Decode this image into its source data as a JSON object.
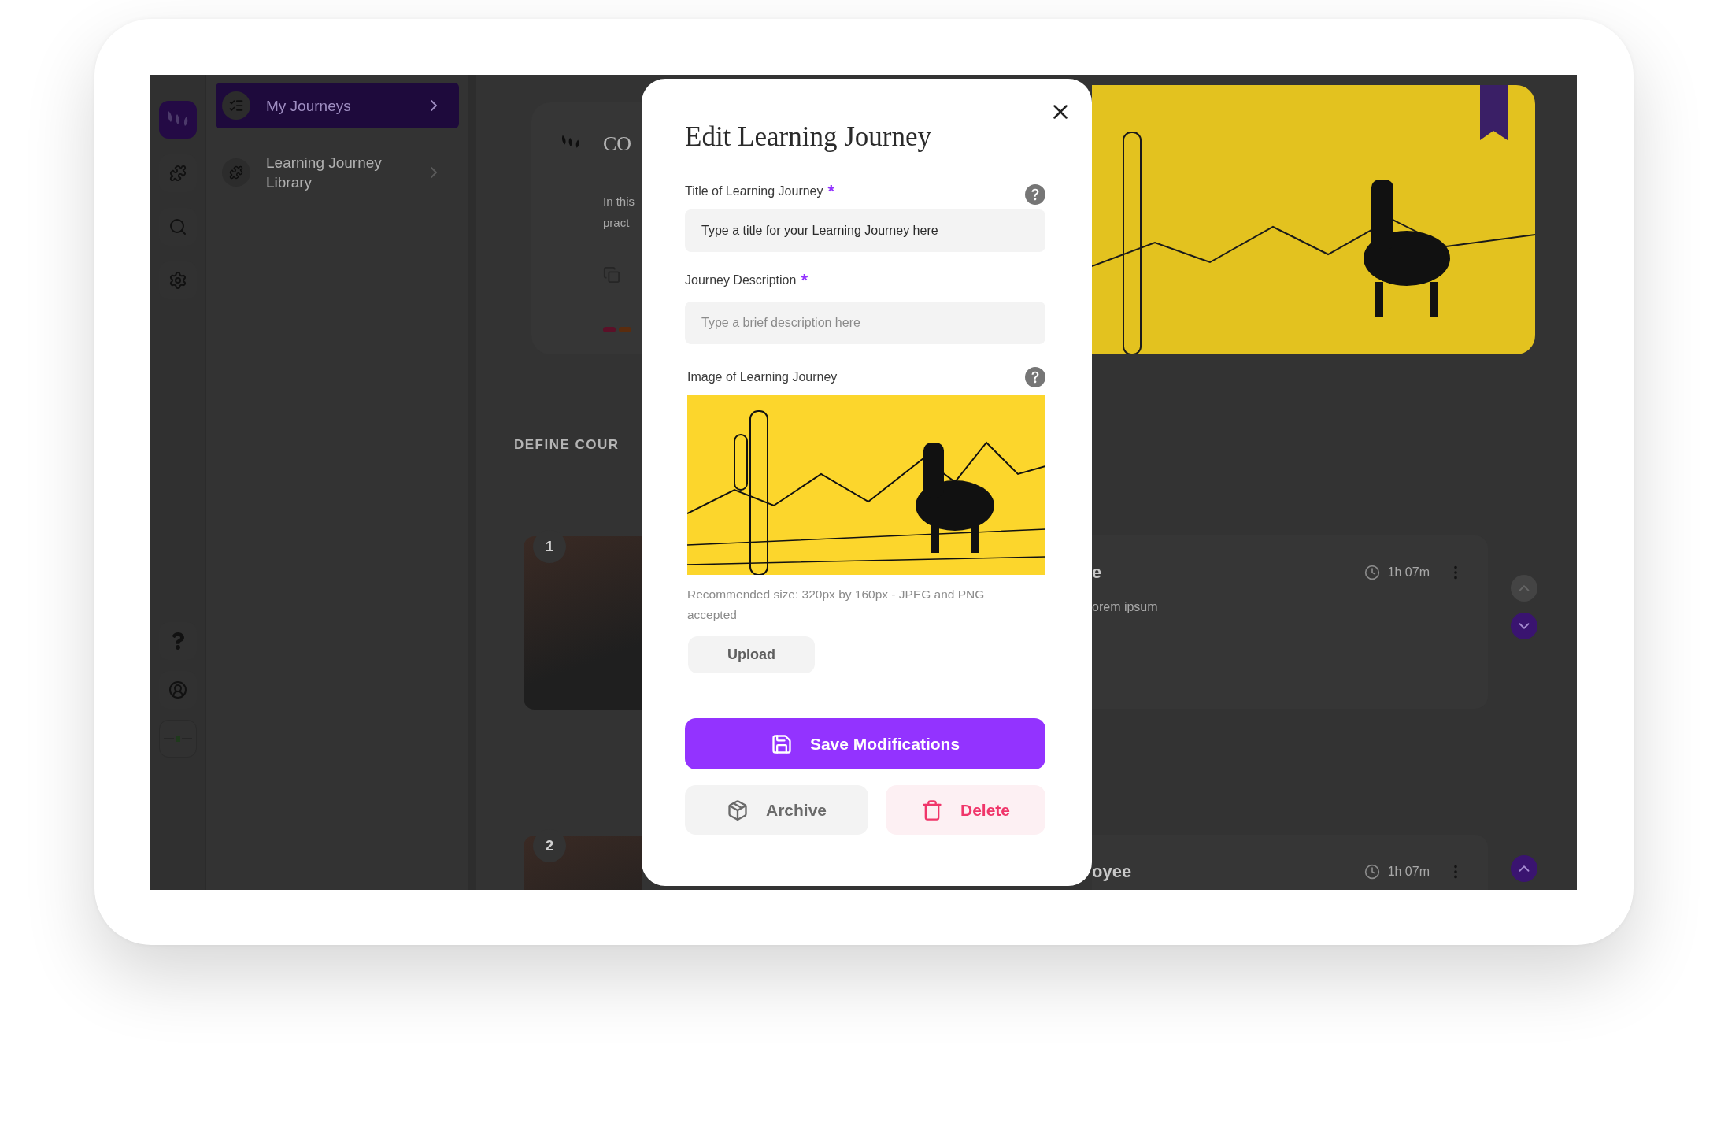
{
  "rail": [
    {
      "kind": "logo",
      "selected": true
    },
    {
      "kind": "puzzle",
      "selected": false
    },
    {
      "kind": "search",
      "selected": false
    },
    {
      "kind": "settings",
      "selected": false
    },
    {
      "kind": "help",
      "selected": false
    },
    {
      "kind": "profile",
      "selected": false
    },
    {
      "kind": "brand",
      "selected": false
    }
  ],
  "nav": [
    {
      "label": "My Journeys",
      "kind": "checklist",
      "selected": true
    },
    {
      "label": "Learning Journey Library",
      "kind": "puzzle",
      "selected": false
    }
  ],
  "course_card": {
    "title": "CO",
    "description_lines": [
      "In this",
      "pract"
    ],
    "tags": [
      {
        "color": "#5c1028"
      },
      {
        "color": "#5a2c0e"
      }
    ]
  },
  "section_heading": "DEFINE COUR",
  "modules": [
    {
      "number": "1",
      "title": "e",
      "description": "orem ipsum",
      "duration": "1h 07m",
      "controls": [
        {
          "kind": "up",
          "disabled": true
        },
        {
          "kind": "down",
          "disabled": false
        }
      ]
    },
    {
      "number": "2",
      "title": "oyee",
      "duration": "1h 07m",
      "controls": [
        {
          "kind": "up",
          "disabled": false
        }
      ]
    }
  ],
  "modal": {
    "title": "Edit Learning Journey",
    "fields": [
      {
        "label": "Title of Learning Journey",
        "required_mark": "*",
        "help": true,
        "value": "Type a title for your Learning Journey here"
      },
      {
        "label": "Journey Description",
        "required_mark": "*",
        "placeholder": "Type a brief description here"
      }
    ],
    "image": {
      "label": "Image of Learning Journey",
      "help": true,
      "hint": "Recommended size: 320px by 160px - JPEG and PNG accepted",
      "upload": "Upload"
    },
    "actions": [
      {
        "kind": "save",
        "label": "Save Modifications"
      },
      {
        "kind": "archive",
        "label": "Archive"
      },
      {
        "kind": "delete",
        "label": "Delete"
      }
    ]
  }
}
